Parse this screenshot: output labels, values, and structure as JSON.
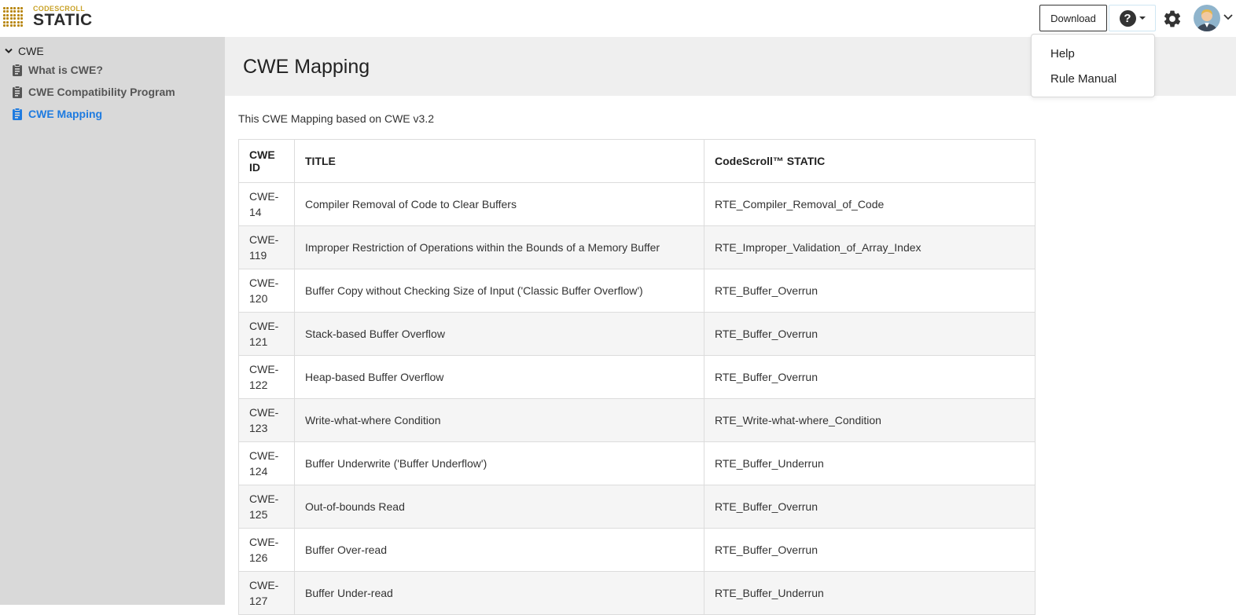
{
  "header": {
    "logo": {
      "small": "CODESCROLL",
      "big": "STATIC"
    },
    "download_label": "Download",
    "help_icon_glyph": "?",
    "icons": [
      "question-circle-icon",
      "gear-icon",
      "avatar",
      "chevron-down-icon"
    ]
  },
  "help_menu": {
    "items": [
      {
        "label": "Help"
      },
      {
        "label": "Rule Manual"
      }
    ]
  },
  "sidebar": {
    "root": {
      "label": "CWE",
      "icon": "chevron-down-icon"
    },
    "items": [
      {
        "label": "What is CWE?",
        "icon": "clipboard-icon",
        "active": false
      },
      {
        "label": "CWE Compatibility Program",
        "icon": "clipboard-icon",
        "active": false
      },
      {
        "label": "CWE Mapping",
        "icon": "clipboard-icon",
        "active": true
      }
    ]
  },
  "main": {
    "title": "CWE Mapping",
    "intro": "This CWE Mapping based on CWE v3.2",
    "table": {
      "headers": {
        "id": "CWE ID",
        "title": "TITLE",
        "rule": "CodeScroll™ STATIC"
      },
      "rows": [
        {
          "id": "CWE-14",
          "title": "Compiler Removal of Code to Clear Buffers",
          "rule": "RTE_Compiler_Removal_of_Code"
        },
        {
          "id": "CWE-119",
          "title": "Improper Restriction of Operations within the Bounds of a Memory Buffer",
          "rule": "RTE_Improper_Validation_of_Array_Index"
        },
        {
          "id": "CWE-120",
          "title": "Buffer Copy without Checking Size of Input ('Classic Buffer Overflow')",
          "rule": "RTE_Buffer_Overrun"
        },
        {
          "id": "CWE-121",
          "title": "Stack-based Buffer Overflow",
          "rule": "RTE_Buffer_Overrun"
        },
        {
          "id": "CWE-122",
          "title": "Heap-based Buffer Overflow",
          "rule": "RTE_Buffer_Overrun"
        },
        {
          "id": "CWE-123",
          "title": "Write-what-where Condition",
          "rule": "RTE_Write-what-where_Condition"
        },
        {
          "id": "CWE-124",
          "title": "Buffer Underwrite ('Buffer Underflow')",
          "rule": "RTE_Buffer_Underrun"
        },
        {
          "id": "CWE-125",
          "title": "Out-of-bounds Read",
          "rule": "RTE_Buffer_Overrun"
        },
        {
          "id": "CWE-126",
          "title": "Buffer Over-read",
          "rule": "RTE_Buffer_Overrun"
        },
        {
          "id": "CWE-127",
          "title": "Buffer Under-read",
          "rule": "RTE_Buffer_Underrun"
        }
      ]
    }
  },
  "colors": {
    "accent": "#1e7be0",
    "sidebar_bg": "#d9d9d9",
    "title_bar_bg": "#efefef",
    "logo_gold": "#c9a227"
  }
}
